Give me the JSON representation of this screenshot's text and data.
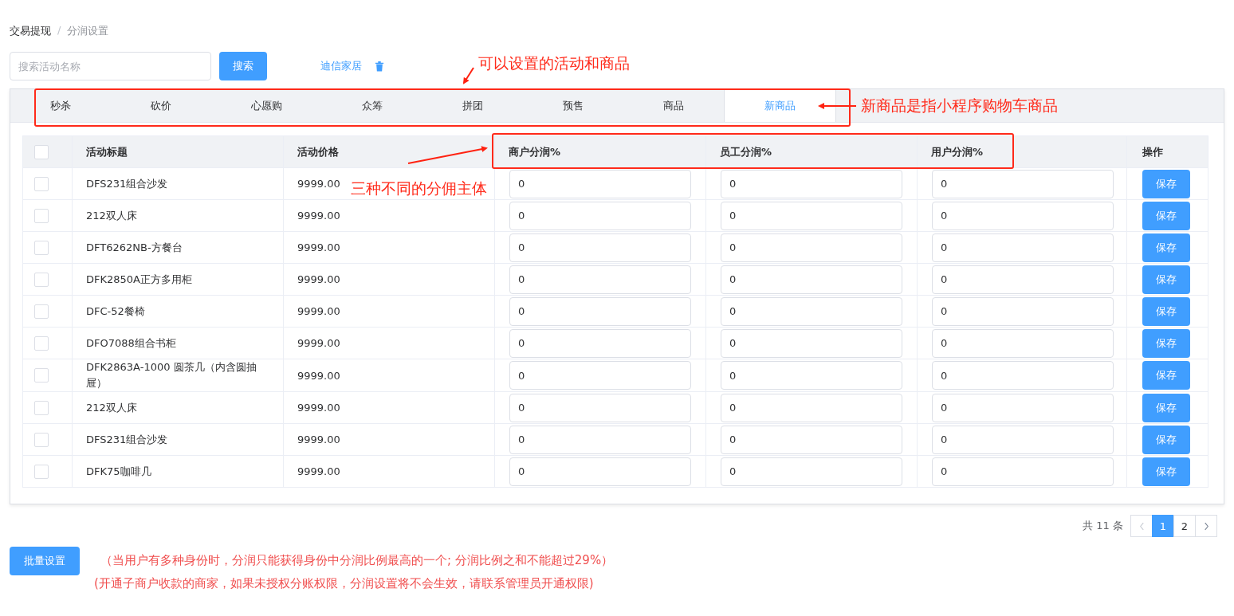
{
  "breadcrumb_separator": "/",
  "breadcrumb": [
    {
      "label": "交易提现",
      "current": false
    },
    {
      "label": "分润设置",
      "current": true
    }
  ],
  "search": {
    "placeholder": "搜索活动名称",
    "button": "搜索"
  },
  "store_link": "迪信家居",
  "tabs": [
    {
      "label": "秒杀",
      "selected": false
    },
    {
      "label": "砍价",
      "selected": false
    },
    {
      "label": "心愿购",
      "selected": false
    },
    {
      "label": "众筹",
      "selected": false
    },
    {
      "label": "拼团",
      "selected": false
    },
    {
      "label": "预售",
      "selected": false
    },
    {
      "label": "商品",
      "selected": false
    },
    {
      "label": "新商品",
      "selected": true
    }
  ],
  "table": {
    "select_all_checked": false,
    "columns": [
      "活动标题",
      "活动价格",
      "商户分润%",
      "员工分润%",
      "用户分润%",
      "操作"
    ],
    "rows": [
      {
        "checked": false,
        "title": "DFS231组合沙发",
        "price": "9999.00",
        "merchant": "0",
        "employee": "0",
        "user": "0",
        "action": "保存"
      },
      {
        "checked": false,
        "title": "212双人床",
        "price": "9999.00",
        "merchant": "0",
        "employee": "0",
        "user": "0",
        "action": "保存"
      },
      {
        "checked": false,
        "title": "DFT6262NB-方餐台",
        "price": "9999.00",
        "merchant": "0",
        "employee": "0",
        "user": "0",
        "action": "保存"
      },
      {
        "checked": false,
        "title": "DFK2850A正方多用柜",
        "price": "9999.00",
        "merchant": "0",
        "employee": "0",
        "user": "0",
        "action": "保存"
      },
      {
        "checked": false,
        "title": "DFC-52餐椅",
        "price": "9999.00",
        "merchant": "0",
        "employee": "0",
        "user": "0",
        "action": "保存"
      },
      {
        "checked": false,
        "title": "DFO7088组合书柜",
        "price": "9999.00",
        "merchant": "0",
        "employee": "0",
        "user": "0",
        "action": "保存"
      },
      {
        "checked": false,
        "title": "DFK2863A-1000 圆茶几（内含圆抽屉）",
        "price": "9999.00",
        "merchant": "0",
        "employee": "0",
        "user": "0",
        "action": "保存"
      },
      {
        "checked": false,
        "title": "212双人床",
        "price": "9999.00",
        "merchant": "0",
        "employee": "0",
        "user": "0",
        "action": "保存"
      },
      {
        "checked": false,
        "title": "DFS231组合沙发",
        "price": "9999.00",
        "merchant": "0",
        "employee": "0",
        "user": "0",
        "action": "保存"
      },
      {
        "checked": false,
        "title": "DFK75咖啡几",
        "price": "9999.00",
        "merchant": "0",
        "employee": "0",
        "user": "0",
        "action": "保存"
      }
    ]
  },
  "pagination": {
    "total": "共 11 条",
    "pages": [
      {
        "label": "1",
        "selected": true
      },
      {
        "label": "2",
        "selected": false
      }
    ]
  },
  "batch_button": "批量设置",
  "notes": [
    "（当用户有多种身份时，分润只能获得身份中分润比例最高的一个; 分润比例之和不能超过29%）",
    "(开通子商户收款的商家，如果未授权分账权限，分润设置将不会生效，请联系管理员开通权限)"
  ],
  "annotations": [
    "可以设置的活动和商品",
    "新商品是指小程序购物车商品",
    "三种不同的分佣主体"
  ]
}
